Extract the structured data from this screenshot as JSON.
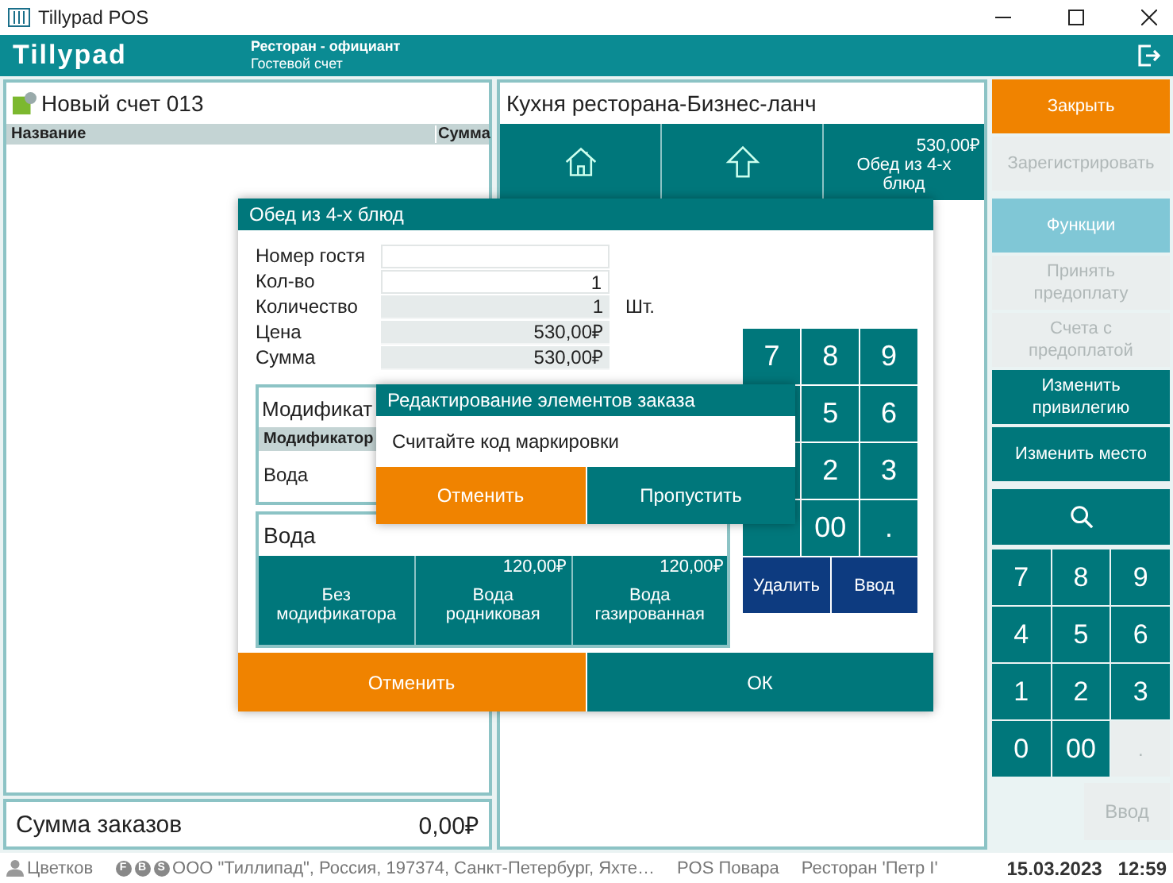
{
  "window": {
    "title": "Tillypad POS"
  },
  "header": {
    "logo": "Tillypad",
    "role": "Ресторан - официант",
    "mode": "Гостевой счет"
  },
  "bill": {
    "title": "Новый счет 013",
    "columns": [
      "Название",
      "Сумма"
    ],
    "total_label": "Сумма заказов",
    "total": "0,00₽"
  },
  "menu": {
    "title": "Кухня ресторана-Бизнес-ланч",
    "buttons": [
      {
        "kind": "home"
      },
      {
        "kind": "up"
      },
      {
        "kind": "item",
        "price": "530,00₽",
        "label": "Обед из 4-х блюд"
      }
    ]
  },
  "actions": [
    {
      "label": "Закрыть",
      "kind": "accent",
      "disabled": false
    },
    {
      "label": "Зарегистрировать",
      "kind": "normal",
      "disabled": true
    },
    {
      "label": "Функции",
      "kind": "function",
      "disabled": false
    },
    {
      "label": "Принять предоплату",
      "kind": "normal",
      "disabled": true
    },
    {
      "label": "Счета с предоплатой",
      "kind": "normal",
      "disabled": true
    },
    {
      "label": "Изменить привилегию",
      "kind": "normal",
      "disabled": false
    },
    {
      "label": "Изменить место",
      "kind": "normal",
      "disabled": false
    }
  ],
  "keypad": {
    "keys": [
      {
        "label": "7",
        "disabled": false
      },
      {
        "label": "8",
        "disabled": false
      },
      {
        "label": "9",
        "disabled": false
      },
      {
        "label": "4",
        "disabled": false
      },
      {
        "label": "5",
        "disabled": false
      },
      {
        "label": "6",
        "disabled": false
      },
      {
        "label": "1",
        "disabled": false
      },
      {
        "label": "2",
        "disabled": false
      },
      {
        "label": "3",
        "disabled": false
      },
      {
        "label": "0",
        "disabled": false
      },
      {
        "label": "00",
        "disabled": false
      },
      {
        "label": ".",
        "disabled": true
      }
    ],
    "enter": {
      "label": "Ввод",
      "disabled": true
    }
  },
  "dialog": {
    "title": "Обед из 4-х блюд",
    "fields": [
      {
        "label": "Номер гостя",
        "editable": true
      },
      {
        "label": "Кол-во",
        "value": "1",
        "editable": true
      },
      {
        "label": "Количество",
        "value": "1",
        "editable": false,
        "unit": "Шт."
      },
      {
        "label": "Цена",
        "value": "530,00₽",
        "editable": false
      },
      {
        "label": "Сумма",
        "value": "530,00₽",
        "editable": false
      }
    ],
    "key_rows": [
      [
        "7",
        "8",
        "9"
      ],
      [
        "5",
        "6"
      ],
      [
        "2",
        "3"
      ],
      [
        "00",
        "."
      ]
    ],
    "delete": "Удалить",
    "enter": "Ввод",
    "modifiers": {
      "title": "Модификат",
      "column": "Модификатор",
      "rows": [
        "Вода"
      ]
    },
    "group": {
      "title": "Вода",
      "buttons": [
        {
          "label": "Без модификатора"
        },
        {
          "price": "120,00₽",
          "label": "Вода родниковая"
        },
        {
          "price": "120,00₽",
          "label": "Вода газированная"
        }
      ]
    },
    "cancel": "Отменить",
    "ok": "ОК"
  },
  "prompt": {
    "title": "Редактирование элементов заказа",
    "message": "Считайте код маркировки",
    "cancel": "Отменить",
    "skip": "Пропустить"
  },
  "status_bar": {
    "user": "Цветков",
    "badges": [
      "F",
      "B",
      "S"
    ],
    "company": "ООО \"Тиллипад\", Россия, 197374, Санкт-Петербург, Яхте…",
    "terminal": "POS Повара",
    "restaurant": "Ресторан 'Петр I'",
    "date": "15.03.2023",
    "time": "12:59"
  }
}
